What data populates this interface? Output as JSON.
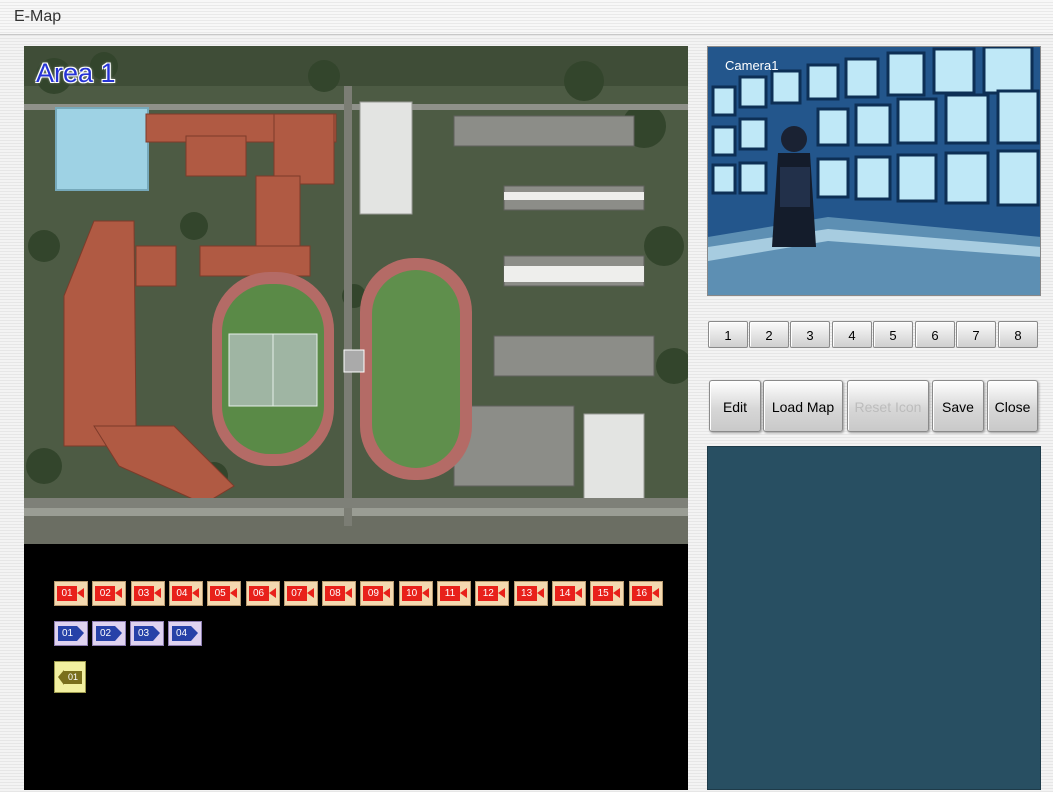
{
  "window": {
    "title": "E-Map"
  },
  "map": {
    "area_label": "Area 1"
  },
  "icons": {
    "cameras": [
      "01",
      "02",
      "03",
      "04",
      "05",
      "06",
      "07",
      "08",
      "09",
      "10",
      "11",
      "12",
      "13",
      "14",
      "15",
      "16"
    ],
    "inputs": [
      "01",
      "02",
      "03",
      "04"
    ],
    "outputs": [
      "01"
    ],
    "camera_color": "#e8211b",
    "input_color": "#2742a8",
    "output_color": "#7a6f1c"
  },
  "camera_view": {
    "label": "Camera1"
  },
  "channels": [
    "1",
    "2",
    "3",
    "4",
    "5",
    "6",
    "7",
    "8"
  ],
  "toolbar": {
    "edit": "Edit",
    "load_map": "Load Map",
    "reset_icon": "Reset Icon",
    "save": "Save",
    "close": "Close"
  },
  "colors": {
    "info_panel": "#284f62",
    "tray_background": "#000000"
  }
}
